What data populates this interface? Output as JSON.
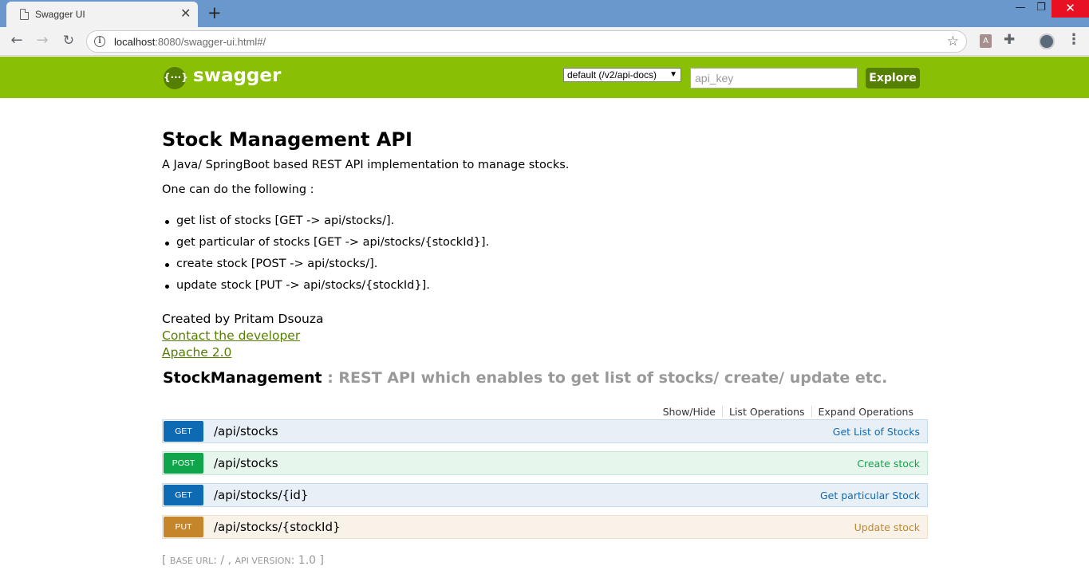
{
  "browser": {
    "tab_title": "Swagger UI",
    "tab_close": "✕",
    "new_tab": "+",
    "url_host": "localhost",
    "url_rest": ":8080/swagger-ui.html#/",
    "window_controls": {
      "minimize": "—",
      "maximize": "❐",
      "close": "✕"
    },
    "icons": [
      "back-arrow-icon",
      "forward-arrow-icon",
      "reload-icon",
      "info-icon",
      "star-icon",
      "pdf-extension-icon",
      "puzzle-extension-icon",
      "profile-avatar",
      "menu-kebab-icon"
    ]
  },
  "header": {
    "logo_icon": "{···}",
    "logo_text": "swagger",
    "spec_select": "default (/v2/api-docs)",
    "api_key_placeholder": "api_key",
    "explore_label": "Explore",
    "bg_color": "#89bf04"
  },
  "info": {
    "title": "Stock Management API",
    "description": "A Java/ SpringBoot based REST API implementation to manage stocks.",
    "intro": "One can do the following :",
    "features": [
      "get list of stocks [GET -> api/stocks/].",
      "get particular of stocks [GET -> api/stocks/{stockId}].",
      "create stock [POST -> api/stocks/].",
      "update stock [PUT -> api/stocks/{stockId}]."
    ],
    "created_by": "Created by Pritam Dsouza",
    "contact_link": "Contact the developer",
    "license_link": "Apache 2.0"
  },
  "resource": {
    "name": "StockManagement",
    "description": ": REST API which enables to get list of stocks/ create/ update etc.",
    "actions": {
      "show_hide": "Show/Hide",
      "list_operations": "List Operations",
      "expand_operations": "Expand Operations"
    },
    "operations": [
      {
        "method": "GET",
        "path": "/api/stocks",
        "summary": "Get List of Stocks"
      },
      {
        "method": "POST",
        "path": "/api/stocks",
        "summary": "Create stock"
      },
      {
        "method": "GET",
        "path": "/api/stocks/{id}",
        "summary": "Get particular Stock"
      },
      {
        "method": "PUT",
        "path": "/api/stocks/{stockId}",
        "summary": "Update stock"
      }
    ]
  },
  "footer": {
    "open": "[ ",
    "base_url_label": "base url",
    "base_url_value": ": / , ",
    "api_version_label": "api version",
    "api_version_value": ": 1.0 ]"
  }
}
